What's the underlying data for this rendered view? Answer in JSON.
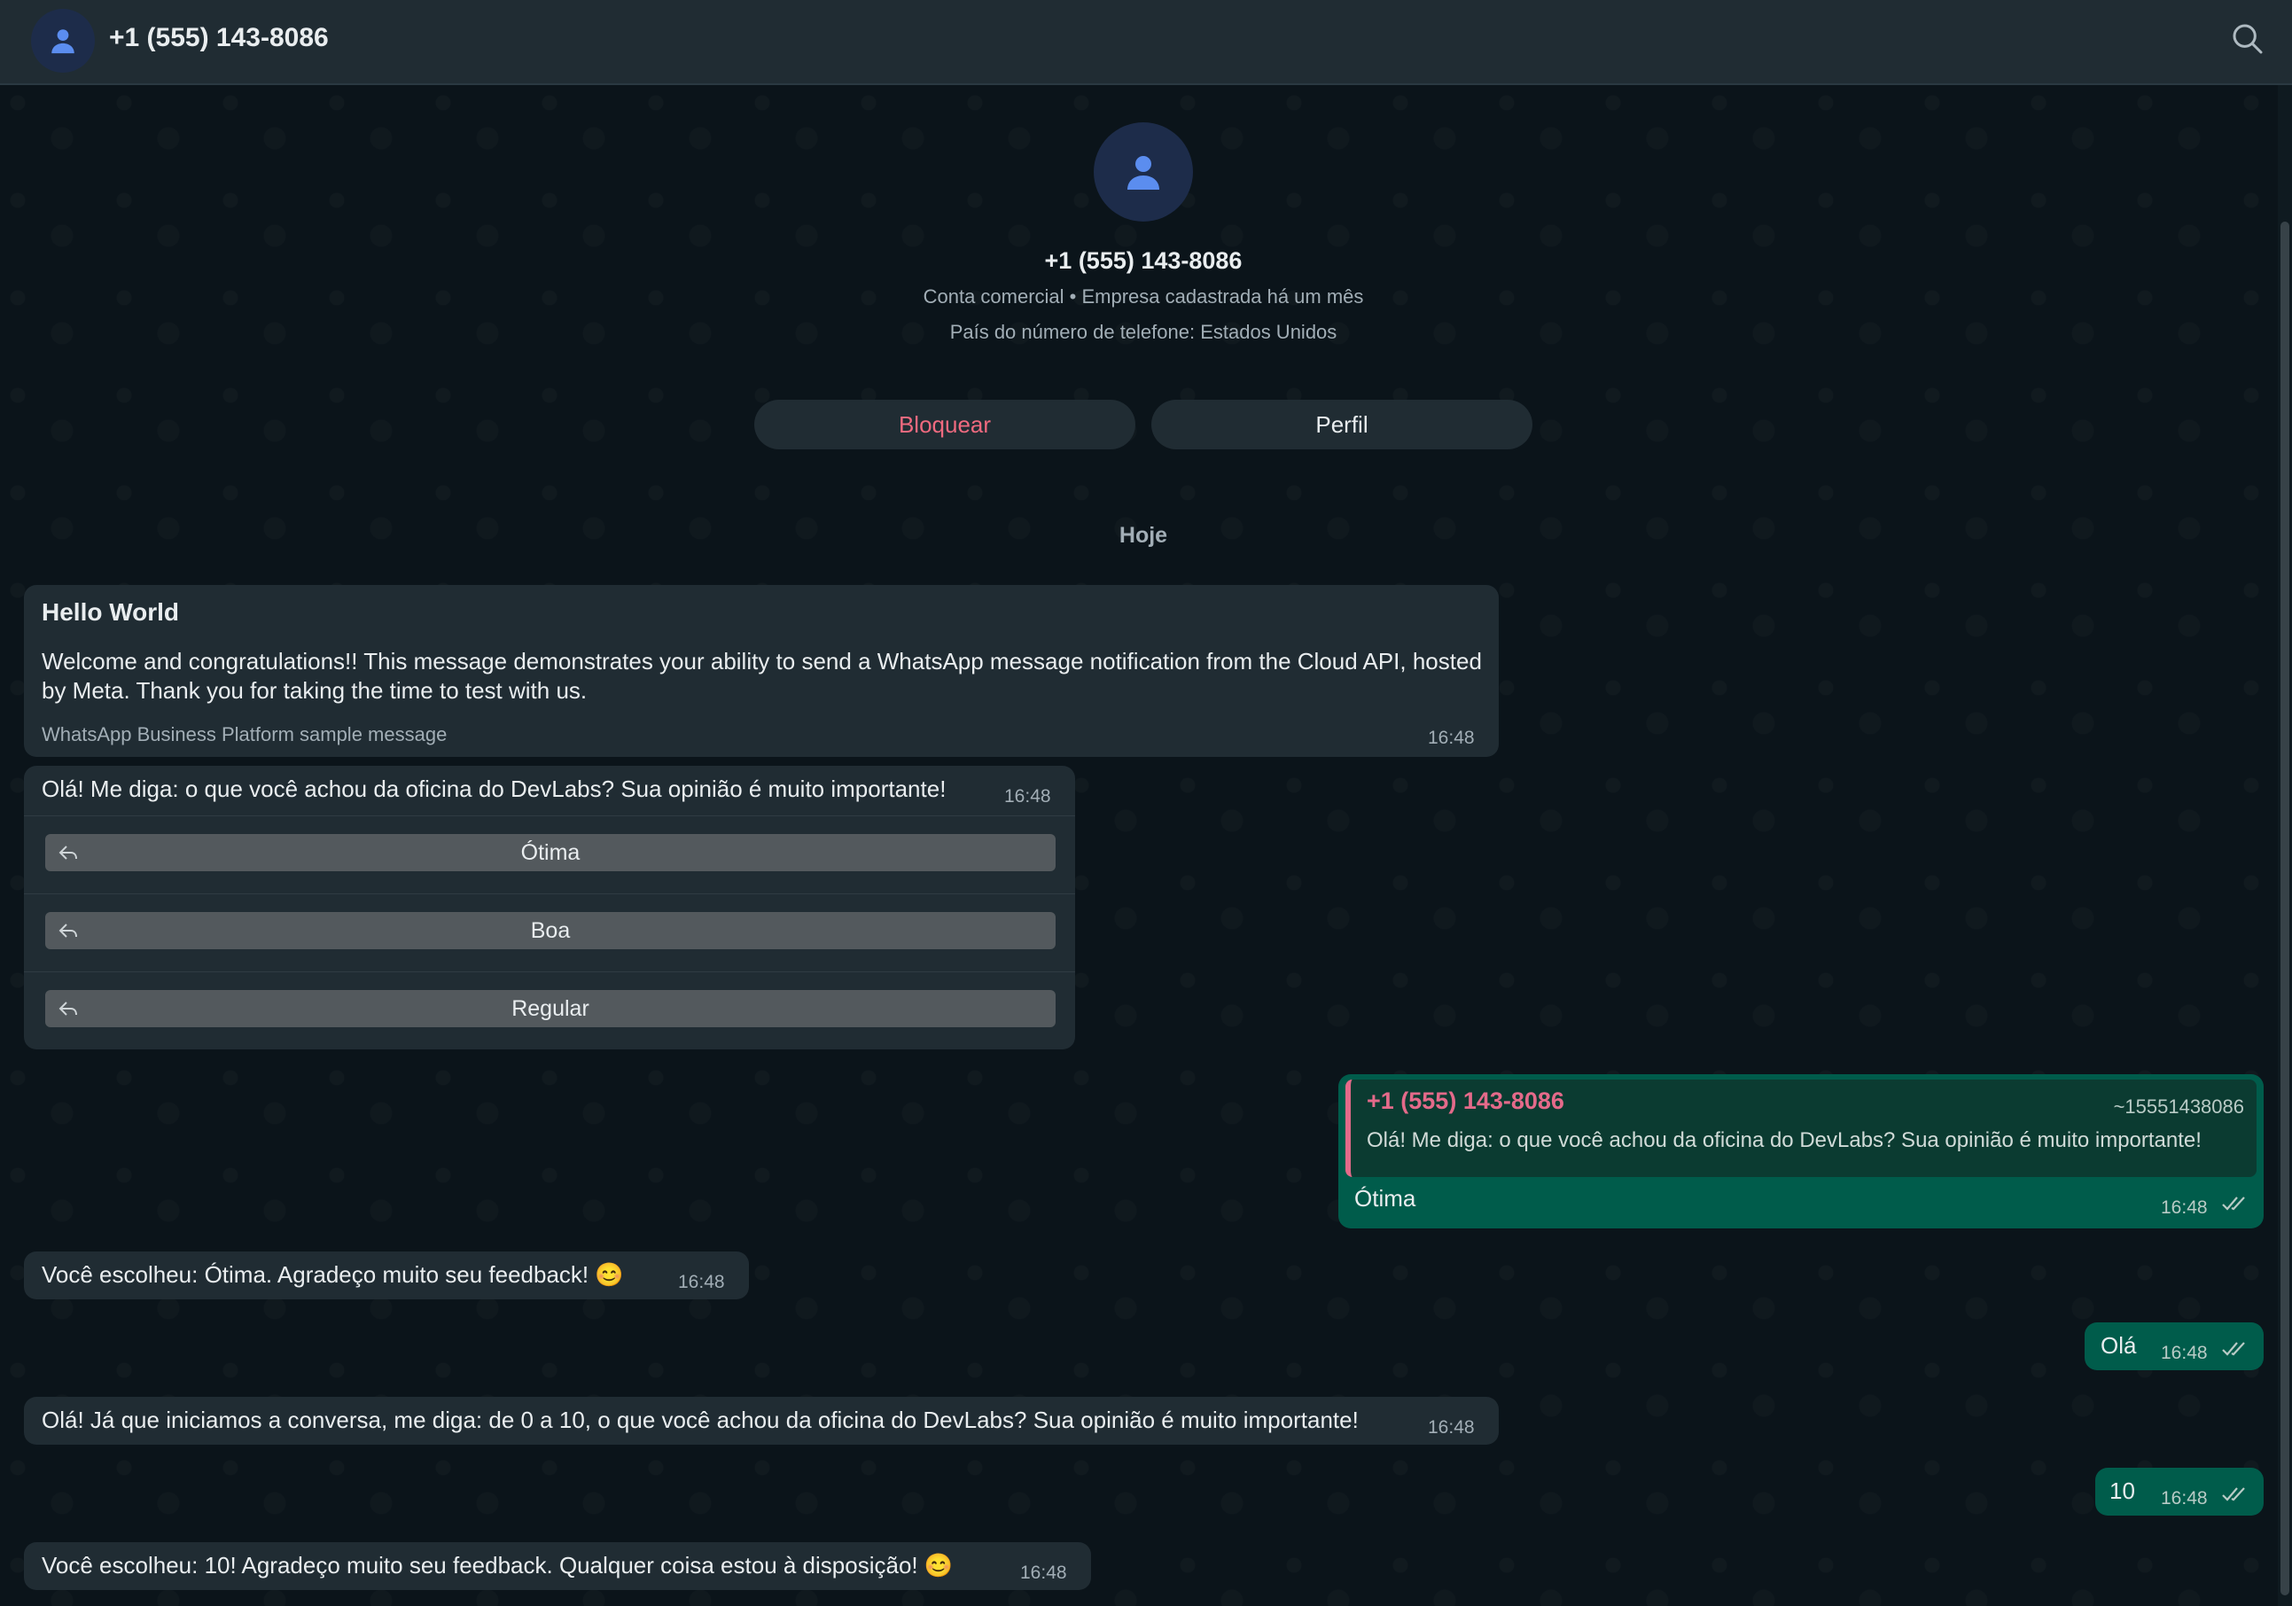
{
  "header": {
    "title": "+1 (555) 143-8086"
  },
  "profile": {
    "name": "+1 (555) 143-8086",
    "line1": "Conta comercial • Empresa cadastrada há um mês",
    "line2": "País do número de telefone: Estados Unidos",
    "block_label": "Bloquear",
    "profile_label": "Perfil"
  },
  "date_chip": "Hoje",
  "messages": {
    "m1": {
      "title": "Hello World",
      "body": "Welcome and congratulations!! This message demonstrates your ability to send a WhatsApp message notification from the Cloud API, hosted by Meta. Thank you for taking the time to test with us.",
      "footer": "WhatsApp Business Platform sample message",
      "time": "16:48"
    },
    "m2": {
      "text": "Olá! Me diga: o que você achou da oficina do DevLabs? Sua opinião é muito importante!",
      "time": "16:48",
      "buttons": [
        "Ótima",
        "Boa",
        "Regular"
      ]
    },
    "m3": {
      "quote_author": "+1 (555) 143-8086",
      "quote_number": "~15551438086",
      "quote_text": "Olá! Me diga: o que você achou da oficina do DevLabs? Sua opinião é muito importante!",
      "text": "Ótima",
      "time": "16:48"
    },
    "m4": {
      "text": "Você escolheu: Ótima. Agradeço muito seu feedback! 😊",
      "time": "16:48"
    },
    "m5": {
      "text": "Olá",
      "time": "16:48"
    },
    "m6": {
      "text": "Olá! Já que iniciamos a conversa, me diga: de 0 a 10, o que você achou da oficina do DevLabs? Sua opinião é muito importante!",
      "time": "16:48"
    },
    "m7": {
      "text": "10",
      "time": "16:48"
    },
    "m8": {
      "text": "Você escolheu: 10! Agradeço muito seu feedback. Qualquer coisa estou à disposição! 😊",
      "time": "16:48"
    }
  },
  "colors": {
    "accent_red": "#ef6a7f",
    "outgoing_bubble": "#005c4b",
    "incoming_bubble": "#202c33",
    "quote_accent": "#e46a8a"
  },
  "icons": [
    "person-avatar-icon",
    "search-icon",
    "reply-arrow-icon",
    "double-check-icon"
  ]
}
